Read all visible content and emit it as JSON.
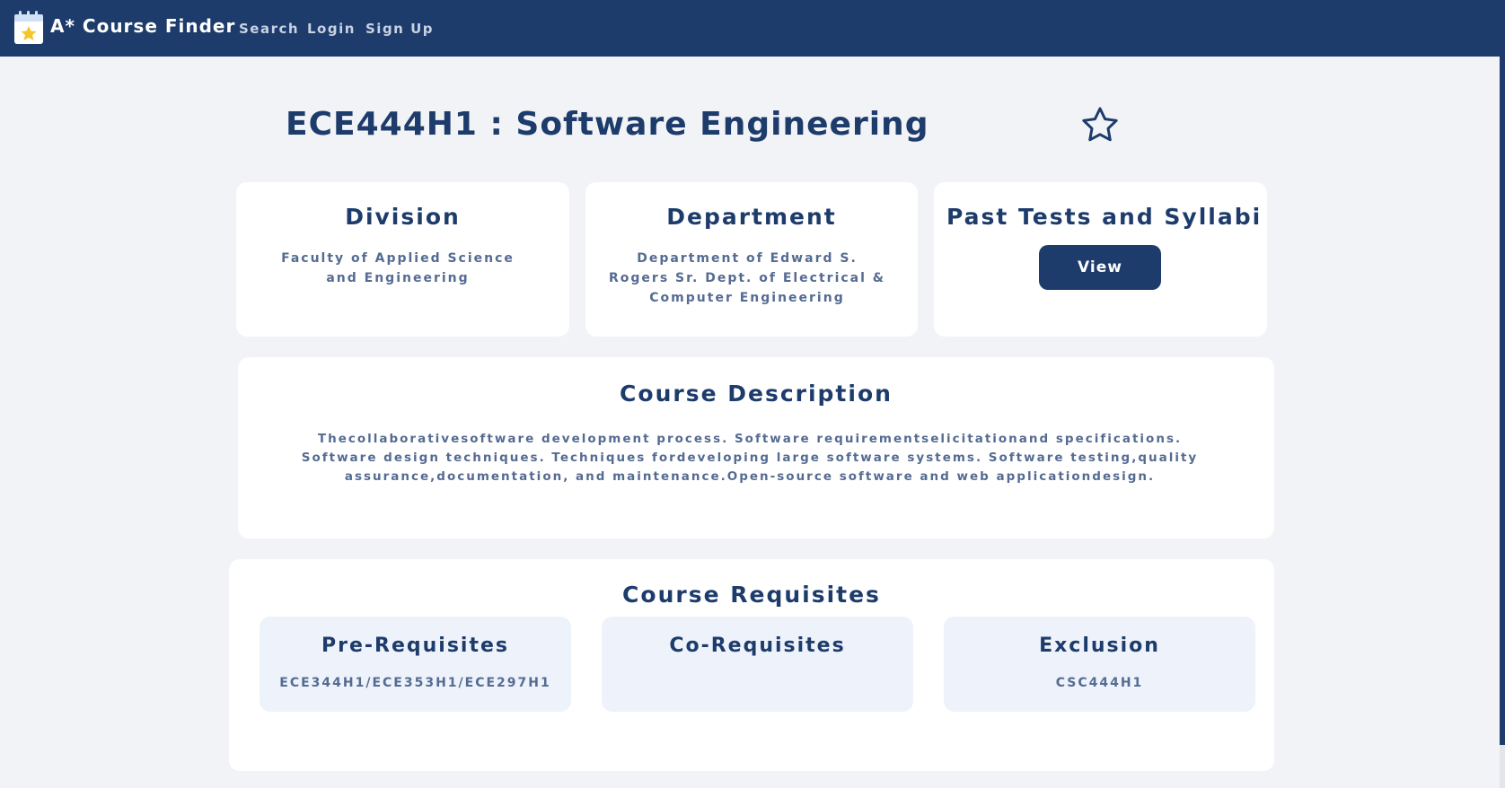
{
  "navbar": {
    "brand": "A* Course Finder",
    "links": [
      "Search",
      "Login",
      "Sign Up"
    ]
  },
  "course": {
    "title": "ECE444H1 : Software Engineering",
    "favorite_icon": "star-outline-icon"
  },
  "division": {
    "heading": "Division",
    "value": "Faculty of Applied Science and Engineering"
  },
  "department": {
    "heading": "Department",
    "value": "Department of Edward S. Rogers Sr. Dept. of Electrical & Computer Engineering"
  },
  "past_tests": {
    "heading": "Past Tests and Syllabi",
    "button_label": "View"
  },
  "description": {
    "heading": "Course Description",
    "text": "Thecollaborativesoftware development process. Software requirementselicitationand specifications. Software design techniques. Techniques fordeveloping large software systems. Software testing,quality assurance,documentation, and maintenance.Open-source software and web applicationdesign."
  },
  "requisites": {
    "heading": "Course Requisites",
    "prereq": {
      "heading": "Pre-Requisites",
      "value": "ECE344H1/ECE353H1/ECE297H1"
    },
    "coreq": {
      "heading": "Co-Requisites",
      "value": ""
    },
    "exclusion": {
      "heading": "Exclusion",
      "value": "CSC444H1"
    }
  },
  "colors": {
    "primary": "#1d3c6b",
    "background": "#f2f3f7",
    "card": "#ffffff",
    "subcard": "#edf2fb",
    "muted_text": "#556b92"
  }
}
